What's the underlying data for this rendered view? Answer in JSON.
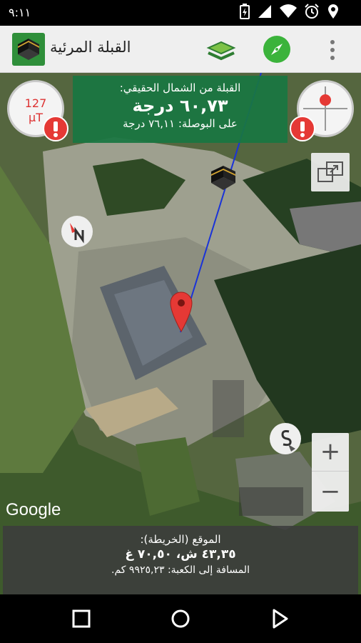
{
  "status_bar": {
    "time": "٩:١١",
    "icons": [
      "battery-charging-icon",
      "signal-icon",
      "wifi-icon",
      "alarm-icon",
      "location-icon"
    ]
  },
  "app_bar": {
    "title": "القبلة المرئية",
    "icons": [
      "kaaba-app-icon",
      "layers-icon",
      "compass-icon",
      "overflow-menu-icon"
    ]
  },
  "qibla_panel": {
    "title": "القبلة من الشمال الحقيقي:",
    "value": "٦٠,٧٣ درجة",
    "compass_text": "على البوصلة: ٧٦,١١ درجة"
  },
  "field_gauge": {
    "value": "127",
    "unit": "µT"
  },
  "map": {
    "attribution": "Google",
    "markers": [
      "north-marker",
      "south-marker",
      "kaaba-marker",
      "location-pin"
    ]
  },
  "zoom": {
    "in_label": "+",
    "out_label": "−"
  },
  "location_panel": {
    "label": "الموقع (الخريطة):",
    "coords": "٤٣,٣٥ ش، ٧٠,٥٠ غ",
    "distance": "المسافة إلى الكعبة: ٩٩٢٥,٢٣ كم."
  },
  "nav_bar": {
    "buttons": [
      "recents-button",
      "home-button",
      "back-button"
    ]
  },
  "colors": {
    "accent": "#1a7642",
    "compass_green": "#3bb33b",
    "alert_red": "#e53935",
    "qibla_line": "#1a33d8"
  }
}
